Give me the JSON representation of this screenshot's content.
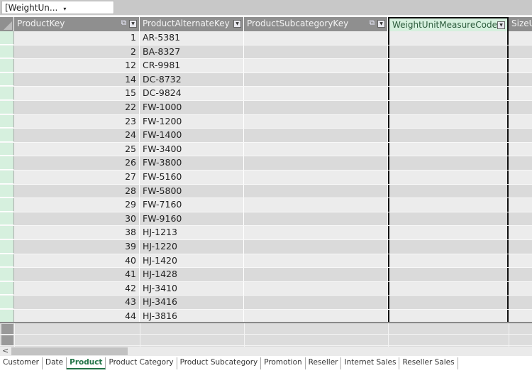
{
  "namebox": {
    "value": "[WeightUn...",
    "arrow": "▾"
  },
  "columns": [
    {
      "label": "ProductKey",
      "icon": "relationship-icon"
    },
    {
      "label": "ProductAlternateKey"
    },
    {
      "label": "ProductSubcategoryKey",
      "icon": "relationship-icon"
    },
    {
      "label": "WeightUnitMeasureCode",
      "selected": true
    },
    {
      "label": "SizeU"
    }
  ],
  "rows": [
    {
      "key": "1",
      "alt": "AR-5381"
    },
    {
      "key": "2",
      "alt": "BA-8327"
    },
    {
      "key": "12",
      "alt": "CR-9981"
    },
    {
      "key": "14",
      "alt": "DC-8732"
    },
    {
      "key": "15",
      "alt": "DC-9824"
    },
    {
      "key": "22",
      "alt": "FW-1000"
    },
    {
      "key": "23",
      "alt": "FW-1200"
    },
    {
      "key": "24",
      "alt": "FW-1400"
    },
    {
      "key": "25",
      "alt": "FW-3400"
    },
    {
      "key": "26",
      "alt": "FW-3800"
    },
    {
      "key": "27",
      "alt": "FW-5160"
    },
    {
      "key": "28",
      "alt": "FW-5800"
    },
    {
      "key": "29",
      "alt": "FW-7160"
    },
    {
      "key": "30",
      "alt": "FW-9160"
    },
    {
      "key": "38",
      "alt": "HJ-1213"
    },
    {
      "key": "39",
      "alt": "HJ-1220"
    },
    {
      "key": "40",
      "alt": "HJ-1420"
    },
    {
      "key": "41",
      "alt": "HJ-1428"
    },
    {
      "key": "42",
      "alt": "HJ-3410"
    },
    {
      "key": "43",
      "alt": "HJ-3416"
    },
    {
      "key": "44",
      "alt": "HJ-3816"
    }
  ],
  "scroll_left": "<",
  "tabs": [
    "Customer",
    "Date",
    "Product",
    "Product Category",
    "Product Subcategory",
    "Promotion",
    "Reseller",
    "Internet Sales",
    "Reseller Sales"
  ],
  "active_tab": "Product"
}
